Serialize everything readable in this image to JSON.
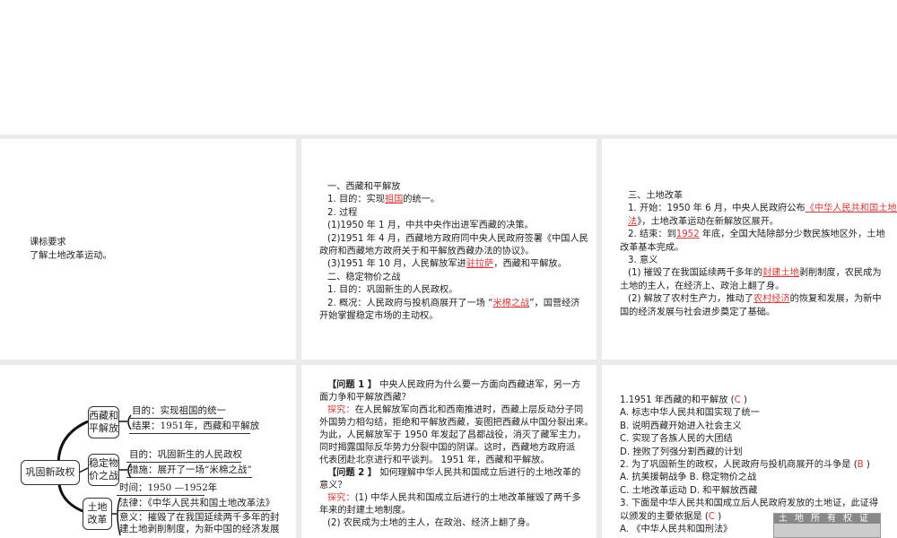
{
  "panel1": {
    "heading": "课标要求",
    "requirement": "了解土地改革运动。"
  },
  "panel2": {
    "lines": [
      {
        "pre": "一、西藏和平解放",
        "blank": "",
        "post": ""
      },
      {
        "pre": "1. 目的：实现",
        "blank": "祖国",
        "post": "的统一。"
      },
      {
        "pre": "2. 过程",
        "blank": "",
        "post": ""
      },
      {
        "pre": "(1)1950 年 1 月，中共中央作出进军西藏的决策。",
        "blank": "",
        "post": ""
      },
      {
        "pre": "(2)1951 年 4 月，西藏地方政府同中央人民政府签署《中国人民",
        "blank": "",
        "post": ""
      },
      {
        "pre": "政府和西藏地方政府关于和平解放西藏办法的协议》。",
        "blank": "",
        "post": ""
      },
      {
        "pre": "(3)1951 年 10 月，人民解放军进",
        "blank": "驻拉萨",
        "post": "，西藏和平解放。"
      },
      {
        "pre": "二、稳定物价之战",
        "blank": "",
        "post": ""
      },
      {
        "pre": "1. 目的：巩固新生的人民政权。",
        "blank": "",
        "post": ""
      },
      {
        "pre": "2. 概况：人民政府与投机商展开了一场 “",
        "blank": "米棉之战",
        "post": "”，国营经济"
      },
      {
        "pre": "开始掌握稳定市场的主动权。",
        "blank": "",
        "post": ""
      }
    ]
  },
  "panel3": {
    "lines": [
      {
        "pre": "三、土地改革",
        "blank": "",
        "post": ""
      },
      {
        "pre": "1. 开始：1950 年 6 月，中央人民政府公布",
        "blank": "《中华人民共和国土地改革",
        "post": ""
      },
      {
        "pre": "",
        "blank": "法",
        "post": "》，土地改革运动在新解放区展开。"
      },
      {
        "pre": "2. 结束：到",
        "blank": "1952",
        "post": " 年底，全国大陆除部分少数民族地区外，土地"
      },
      {
        "pre": "改革基本完成。",
        "blank": "",
        "post": ""
      },
      {
        "pre": "3. 意义",
        "blank": "",
        "post": ""
      },
      {
        "pre": "(1) 摧毁了在我国延续两千多年的",
        "blank": "封建土地",
        "post": "剥削制度，农民成为"
      },
      {
        "pre": "土地的主人，在经济上、政治上翻了身。",
        "blank": "",
        "post": ""
      },
      {
        "pre": "(2) 解放了农村生产力，推动了",
        "blank": "农村经济",
        "post": "的恢复和发展，为新中"
      },
      {
        "pre": "国的经济发展与社会进步奠定了基础。",
        "blank": "",
        "post": ""
      }
    ]
  },
  "mindmap": {
    "root": "巩固新政权",
    "branches": [
      {
        "label": "西藏和平解放",
        "leaves": [
          "目的：实现祖国的统一",
          "结果：1951年，西藏和平解放"
        ]
      },
      {
        "label": "稳定物价之战",
        "leaves": [
          "目的：巩固新生的人民政权",
          "措施：展开了一场“米棉之战”"
        ]
      },
      {
        "label": "土地改革",
        "leaves": [
          "时间：1950 —1952年",
          "法律：《中华人民共和国土地改革法》",
          "意义：摧毁了在我国延续两千多年的封",
          "建土地剥削制度，为新中国的经济发展"
        ]
      }
    ]
  },
  "panel5": {
    "q1_tag": "【问题 1 】",
    "q1": "中央人民政府为什么要一方面向西藏进军，另一方",
    "q1b": "面力争和平解放西藏？",
    "explore_label": "探究：",
    "a1": [
      "在人民解放军向西北和西南推进时，西藏上层反动分子同",
      "外国势力相勾结，拒绝和平解放西藏，妄图把西藏从中国分裂出来。",
      "为此，人民解放军于 1950 年发起了昌都战役，消灭了藏军主力，",
      "同时揭露国际反华势力分裂中国的阴谋。这时，西藏地方政府派",
      "代表团赴北京进行和平谈判。 1951 年，西藏和平解放。"
    ],
    "q2_tag": "【问题 2 】",
    "q2": "如何理解中华人民共和国成立后进行的土地改革的",
    "q2b": "意义？",
    "a2": [
      "(1) 中华人民共和国成立后进行的土地改革摧毁了两千多",
      "年来的封建土地制度。",
      "(2) 农民成为土地的主人，在政治、经济上翻了身。"
    ]
  },
  "panel6": {
    "q1": {
      "stem": "1.1951 年西藏的和平解放 (",
      "answer": "C",
      "close": "  )",
      "options": [
        "A. 标志中华人民共和国实现了统一",
        "B. 说明西藏开始进入社会主义",
        "C. 实现了各族人民的大团结",
        "D. 挫败了列强分割西藏的计划"
      ]
    },
    "q2": {
      "stem": "2. 为了巩固新生的政权，人民政府与投机商展开的斗争是 (",
      "answer": "B",
      "close": "  )",
      "options": [
        "A. 抗美援朝战争    B. 稳定物价之战",
        "C. 土地改革运动    D. 和平解放西藏"
      ]
    },
    "q3": {
      "stem": "3. 下面是中华人民共和国成立后人民政府发放的土地证，此证得",
      "stem2": "以颁发的主要依据是 (",
      "answer": "C",
      "close": "  )",
      "options": [
        "A. 《中华人民共和国刑法》"
      ]
    },
    "photo_caption": "土地所有权证"
  }
}
